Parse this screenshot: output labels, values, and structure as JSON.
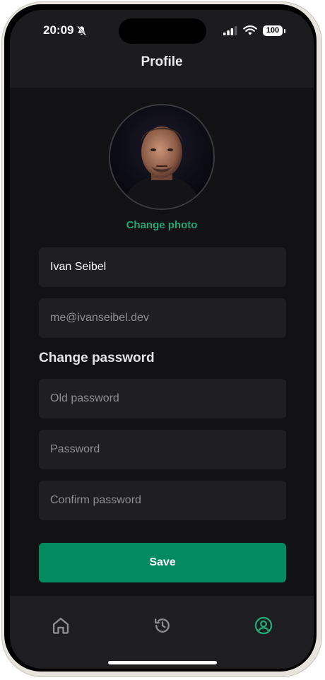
{
  "status_bar": {
    "time": "20:09",
    "battery": "100",
    "icons": [
      "bell-slash-icon",
      "cellular-signal-icon",
      "wifi-icon",
      "battery-icon"
    ]
  },
  "header": {
    "title": "Profile"
  },
  "profile": {
    "avatar_icon": "profile-photo",
    "change_photo_label": "Change photo"
  },
  "form": {
    "name_value": "Ivan Seibel",
    "email_placeholder": "me@ivanseibel.dev",
    "change_password_title": "Change password",
    "old_password_placeholder": "Old password",
    "password_placeholder": "Password",
    "confirm_password_placeholder": "Confirm password",
    "save_label": "Save"
  },
  "tabbar": {
    "tabs": [
      {
        "icon": "home-icon",
        "active": false
      },
      {
        "icon": "history-icon",
        "active": false
      },
      {
        "icon": "user-circle-icon",
        "active": true
      }
    ]
  },
  "colors": {
    "accent": "#1fa874",
    "button": "#048a5f",
    "background": "#121214",
    "field": "#1f1f23"
  }
}
